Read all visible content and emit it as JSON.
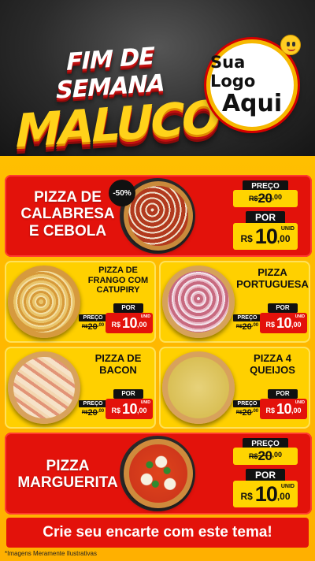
{
  "header": {
    "title_line1": "FIM DE SEMANA",
    "title_line2": "MALUCO",
    "logo_line1": "Sua Logo",
    "logo_line2": "Aqui"
  },
  "labels": {
    "preco": "PREÇO",
    "por": "POR",
    "unid": "UNID",
    "currency": "R$"
  },
  "items": [
    {
      "name_line1": "PIZZA DE",
      "name_line2": "CALABRESA",
      "name_line3": "E CEBOLA",
      "discount": "-50%",
      "old_int": "20",
      "old_dec": ",00",
      "new_int": "10",
      "new_dec": ",00"
    },
    {
      "name_line1": "PIZZA DE",
      "name_line2": "FRANGO COM",
      "name_line3": "CATUPIRY",
      "old_int": "20",
      "old_dec": ",00",
      "new_int": "10",
      "new_dec": ",00"
    },
    {
      "name_line1": "PIZZA",
      "name_line2": "PORTUGUESA",
      "old_int": "20",
      "old_dec": ",00",
      "new_int": "10",
      "new_dec": ",00"
    },
    {
      "name_line1": "PIZZA DE",
      "name_line2": "BACON",
      "old_int": "20",
      "old_dec": ",00",
      "new_int": "10",
      "new_dec": ",00"
    },
    {
      "name_line1": "PIZZA 4",
      "name_line2": "QUEIJOS",
      "old_int": "20",
      "old_dec": ",00",
      "new_int": "10",
      "new_dec": ",00"
    },
    {
      "name_line1": "PIZZA",
      "name_line2": "MARGUERITA",
      "old_int": "20",
      "old_dec": ",00",
      "new_int": "10",
      "new_dec": ",00"
    }
  ],
  "footer": {
    "banner": "Crie seu encarte com este tema!",
    "disclaimer": "*Imagens Meramente Ilustrativas"
  },
  "colors": {
    "red": "#e3120b",
    "yellow": "#ffd000",
    "board": "#ffb800",
    "dark": "#111111"
  }
}
